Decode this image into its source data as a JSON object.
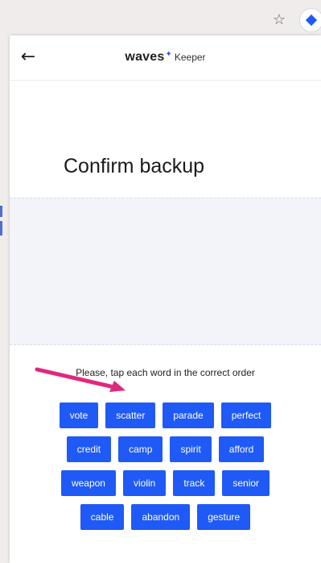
{
  "browser": {
    "star_icon": "☆",
    "extension_icon": "waves-keeper-extension-icon"
  },
  "header": {
    "back_icon": "←",
    "brand": "waves",
    "brand_mark": "✦",
    "product": "Keeper"
  },
  "page": {
    "title": "Confirm backup",
    "instruction": "Please, tap each word in the correct order"
  },
  "words": {
    "row1": [
      "vote",
      "scatter",
      "parade",
      "perfect"
    ],
    "row2": [
      "credit",
      "camp",
      "spirit",
      "afford"
    ],
    "row3": [
      "weapon",
      "violin",
      "track",
      "senior"
    ],
    "row4": [
      "cable",
      "abandon",
      "gesture"
    ]
  },
  "colors": {
    "accent": "#1f5af6",
    "annotation_arrow": "#e0287c",
    "phrase_area_bg": "#f3f4f9"
  }
}
